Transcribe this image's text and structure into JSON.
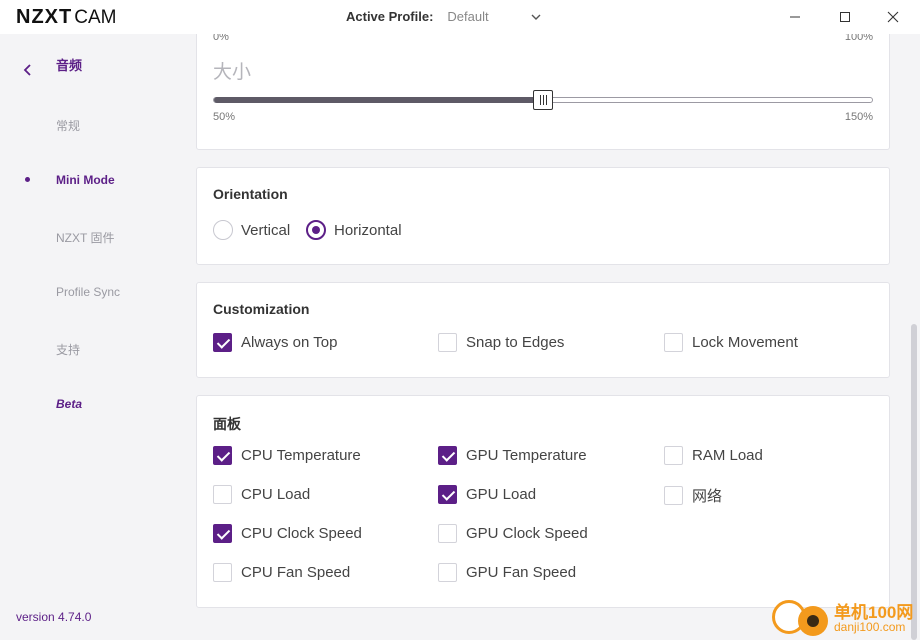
{
  "titlebar": {
    "brand": "NZXT",
    "app": "CAM",
    "profile_label": "Active Profile:",
    "profile_value": "Default"
  },
  "sidebar": {
    "back_label": "音频",
    "items": [
      {
        "label": "常规"
      },
      {
        "label": "Mini Mode",
        "active": true
      },
      {
        "label": "NZXT 固件"
      },
      {
        "label": "Profile Sync"
      },
      {
        "label": "支持"
      },
      {
        "label": "Beta"
      }
    ],
    "version": "version 4.74.0"
  },
  "opacity": {
    "min_label": "0%",
    "max_label": "100%"
  },
  "size": {
    "title": "大小",
    "min_label": "50%",
    "max_label": "150%",
    "value_fraction": 0.5
  },
  "orientation": {
    "title": "Orientation",
    "options": [
      {
        "label": "Vertical",
        "selected": false
      },
      {
        "label": "Horizontal",
        "selected": true
      }
    ]
  },
  "customization": {
    "title": "Customization",
    "options": [
      {
        "label": "Always on Top",
        "checked": true
      },
      {
        "label": "Snap to Edges",
        "checked": false
      },
      {
        "label": "Lock Movement",
        "checked": false
      }
    ]
  },
  "panels": {
    "title": "面板",
    "options": [
      {
        "label": "CPU Temperature",
        "checked": true
      },
      {
        "label": "GPU Temperature",
        "checked": true
      },
      {
        "label": "RAM Load",
        "checked": false
      },
      {
        "label": "CPU Load",
        "checked": false
      },
      {
        "label": "GPU Load",
        "checked": true
      },
      {
        "label": "网络",
        "checked": false
      },
      {
        "label": "CPU Clock Speed",
        "checked": true
      },
      {
        "label": "GPU Clock Speed",
        "checked": false
      },
      {
        "label": "CPU Fan Speed",
        "checked": false
      },
      {
        "label": "GPU Fan Speed",
        "checked": false
      }
    ]
  },
  "watermark": {
    "line1": "单机100网",
    "line2": "danji100.com"
  },
  "colors": {
    "accent": "#5c1f87",
    "watermark": "#f39a1d"
  }
}
